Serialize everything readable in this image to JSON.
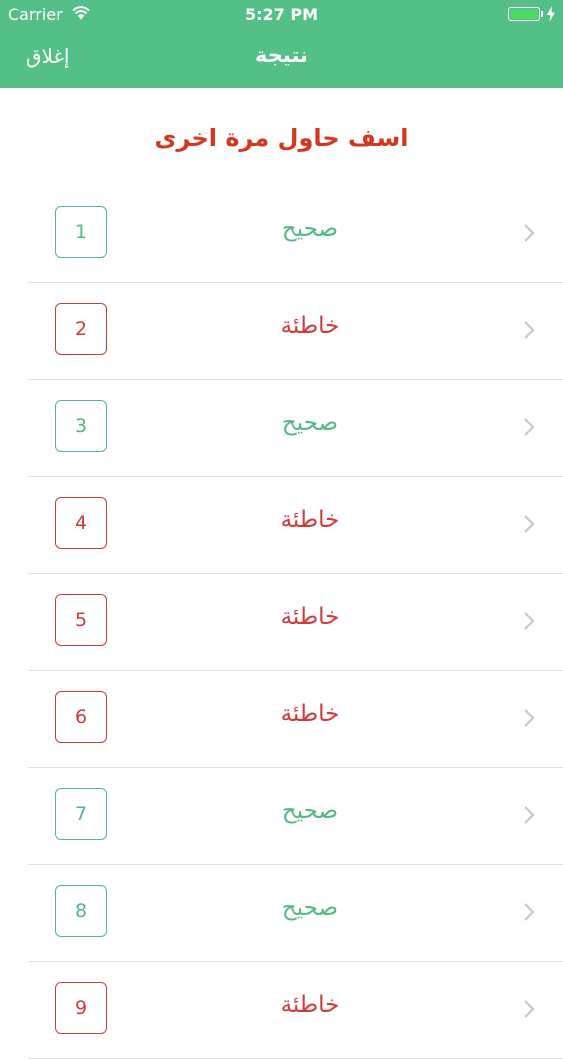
{
  "status_bar": {
    "carrier": "Carrier",
    "time": "5:27 PM"
  },
  "navbar": {
    "close_label": "إغلاق",
    "title": "نتيجة"
  },
  "result_message": "اسف حاول مرة اخرى",
  "colors": {
    "header_green": "#54c087",
    "correct_green": "#52b884",
    "wrong_red": "#d23a3a",
    "message_red": "#d7361e"
  },
  "results": [
    {
      "number": "1",
      "status": "صحيح",
      "correct": true
    },
    {
      "number": "2",
      "status": "خاطئة",
      "correct": false
    },
    {
      "number": "3",
      "status": "صحيح",
      "correct": true
    },
    {
      "number": "4",
      "status": "خاطئة",
      "correct": false
    },
    {
      "number": "5",
      "status": "خاطئة",
      "correct": false
    },
    {
      "number": "6",
      "status": "خاطئة",
      "correct": false
    },
    {
      "number": "7",
      "status": "صحيح",
      "correct": true
    },
    {
      "number": "8",
      "status": "صحيح",
      "correct": true
    },
    {
      "number": "9",
      "status": "خاطئة",
      "correct": false
    }
  ]
}
